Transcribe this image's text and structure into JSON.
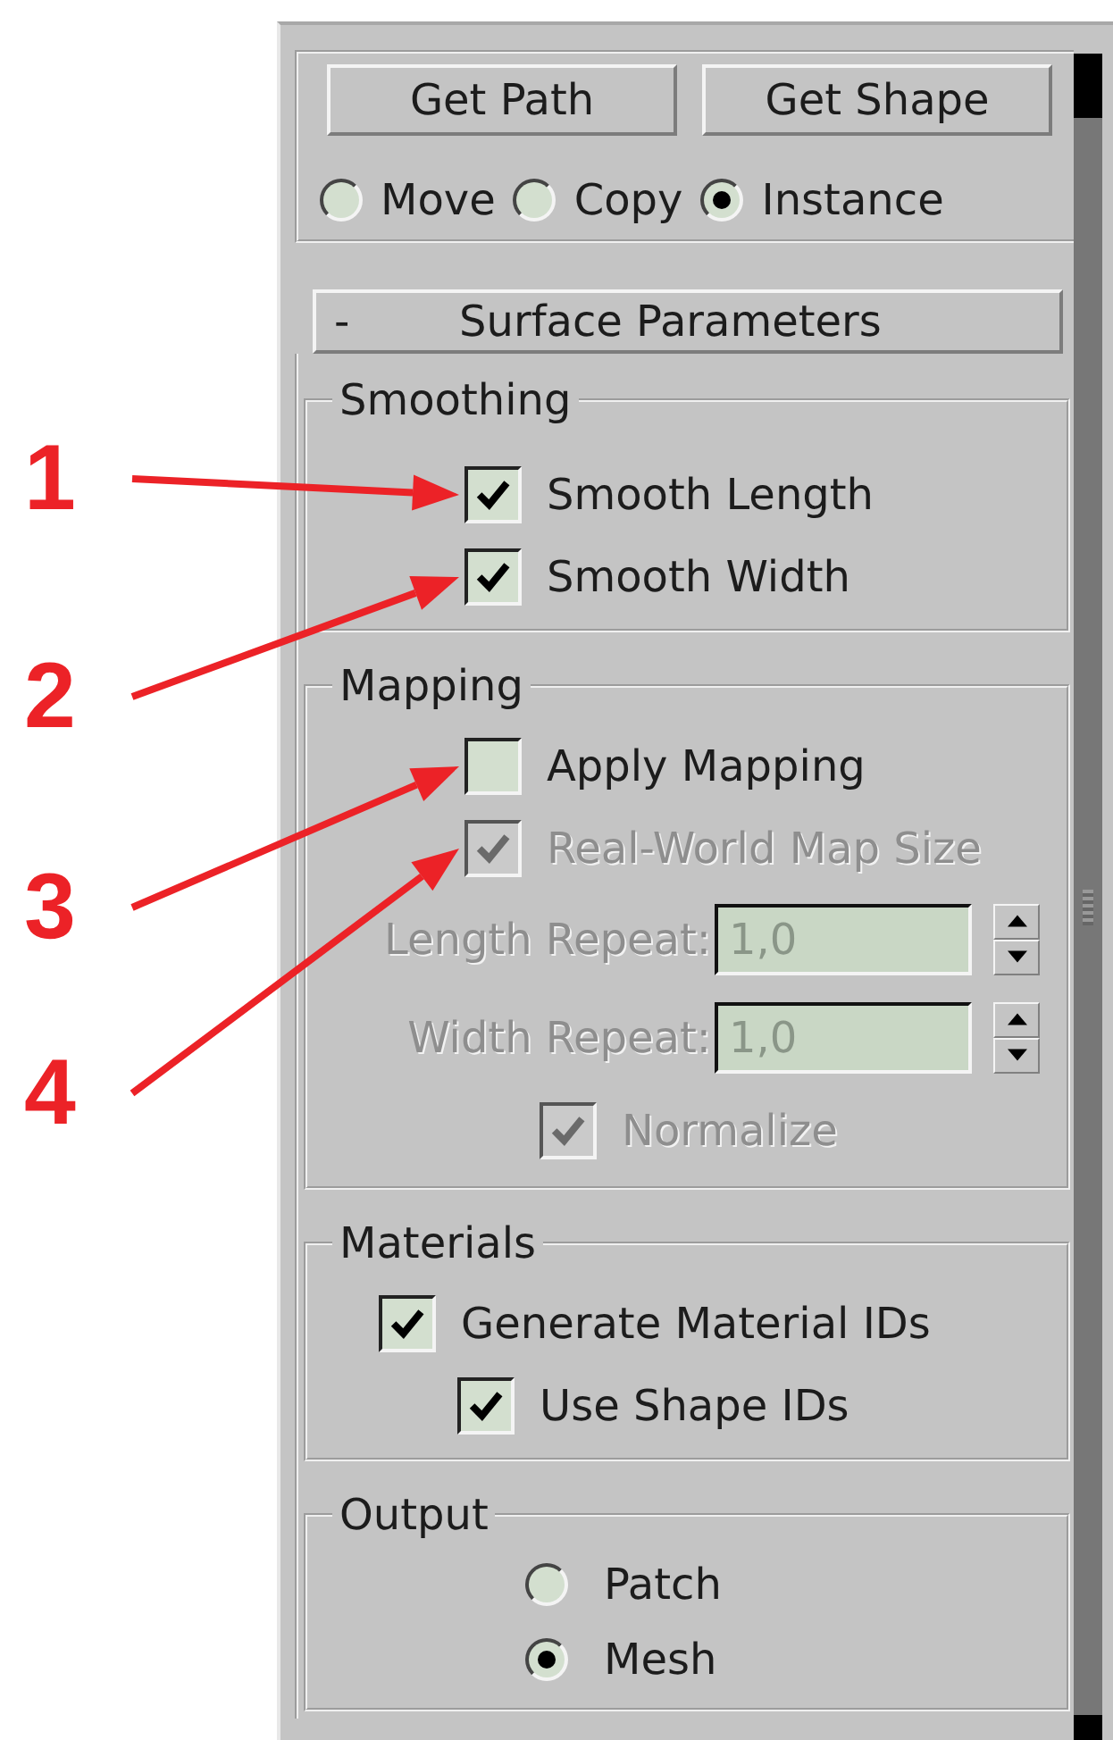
{
  "top_buttons": [
    "Get Path",
    "Get Shape"
  ],
  "clone_mode": [
    {
      "label": "Move",
      "selected": false
    },
    {
      "label": "Copy",
      "selected": false
    },
    {
      "label": "Instance",
      "selected": true
    }
  ],
  "rollout": {
    "toggle": "-",
    "title": "Surface Parameters"
  },
  "groups": [
    {
      "title": "Smoothing",
      "items": [
        {
          "kind": "checkbox",
          "label": "Smooth Length",
          "checked": true,
          "disabled": false,
          "callout": "1"
        },
        {
          "kind": "checkbox",
          "label": "Smooth Width",
          "checked": true,
          "disabled": false,
          "callout": "2"
        }
      ]
    },
    {
      "title": "Mapping",
      "items": [
        {
          "kind": "checkbox",
          "label": "Apply Mapping",
          "checked": false,
          "disabled": false,
          "callout": "3"
        },
        {
          "kind": "checkbox",
          "label": "Real-World Map Size",
          "checked": true,
          "disabled": true,
          "callout": "4"
        },
        {
          "kind": "spinner",
          "label": "Length Repeat:",
          "value": "1,0",
          "disabled": true
        },
        {
          "kind": "spinner",
          "label": "Width Repeat:",
          "value": "1,0",
          "disabled": true
        },
        {
          "kind": "checkbox",
          "label": "Normalize",
          "checked": true,
          "disabled": true
        }
      ]
    },
    {
      "title": "Materials",
      "items": [
        {
          "kind": "checkbox",
          "label": "Generate Material IDs",
          "checked": true,
          "disabled": false,
          "children": [
            {
              "kind": "checkbox",
              "label": "Use Shape IDs",
              "checked": true,
              "disabled": false
            }
          ]
        }
      ]
    },
    {
      "title": "Output",
      "items": [
        {
          "kind": "radio",
          "label": "Patch",
          "selected": false
        },
        {
          "kind": "radio",
          "label": "Mesh",
          "selected": true
        }
      ]
    }
  ]
}
